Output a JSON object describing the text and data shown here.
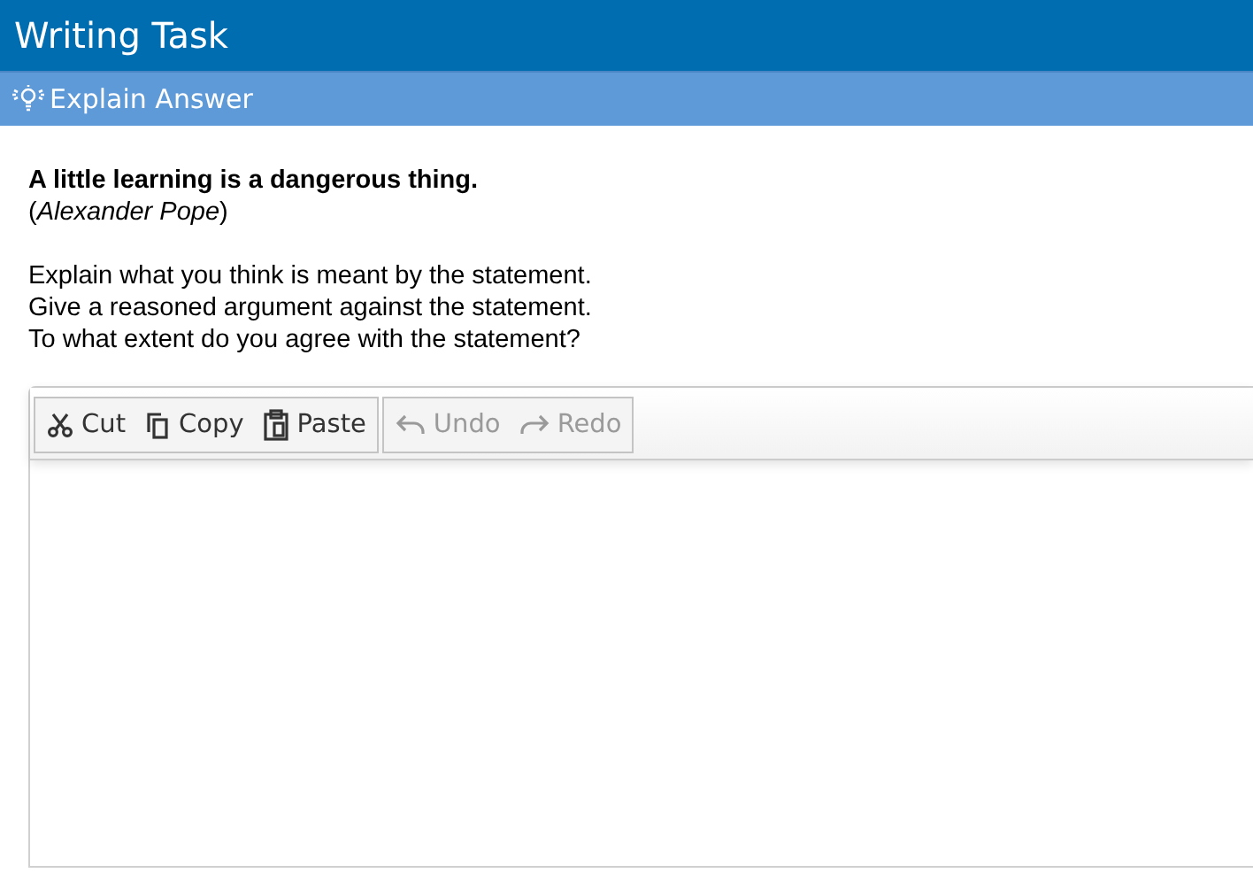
{
  "window": {
    "title": "Writing Task"
  },
  "section": {
    "title": "Explain Answer"
  },
  "quote": {
    "text": "A little learning is a dangerous thing.",
    "author": "(*Alexander Pope*)"
  },
  "instructions": [
    "Explain what you think is meant by the statement.",
    "Give a reasoned argument against the statement.",
    "To what extent do you agree with the statement?"
  ],
  "toolbar": [
    [
      {
        "kind": "cut",
        "label": "Cut",
        "disabled": false
      },
      {
        "kind": "copy",
        "label": "Copy",
        "disabled": false
      },
      {
        "kind": "paste",
        "label": "Paste",
        "disabled": false
      }
    ],
    [
      {
        "kind": "undo",
        "label": "Undo",
        "disabled": true
      },
      {
        "kind": "redo",
        "label": "Redo",
        "disabled": true
      }
    ]
  ]
}
